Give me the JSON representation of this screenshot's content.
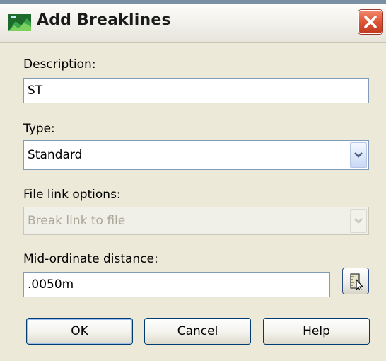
{
  "window": {
    "title": "Add Breaklines"
  },
  "form": {
    "description_label": "Description:",
    "description_value": "ST",
    "type_label": "Type:",
    "type_value": "Standard",
    "file_link_label": "File link options:",
    "file_link_value": "Break link to file",
    "mid_ordinate_label": "Mid-ordinate distance:",
    "mid_ordinate_value": ".0050m"
  },
  "buttons": {
    "ok": "OK",
    "cancel": "Cancel",
    "help": "Help"
  },
  "icons": {
    "app": "civil3d-surface-icon",
    "close": "close-icon",
    "dropdown": "chevron-down-icon",
    "pick": "pick-distance-icon"
  },
  "colors": {
    "close_button": "#e0583a",
    "field_border": "#7f9db9",
    "button_border": "#003c74",
    "dialog_bg": "#ece9d8",
    "disabled_text": "#aca899"
  }
}
